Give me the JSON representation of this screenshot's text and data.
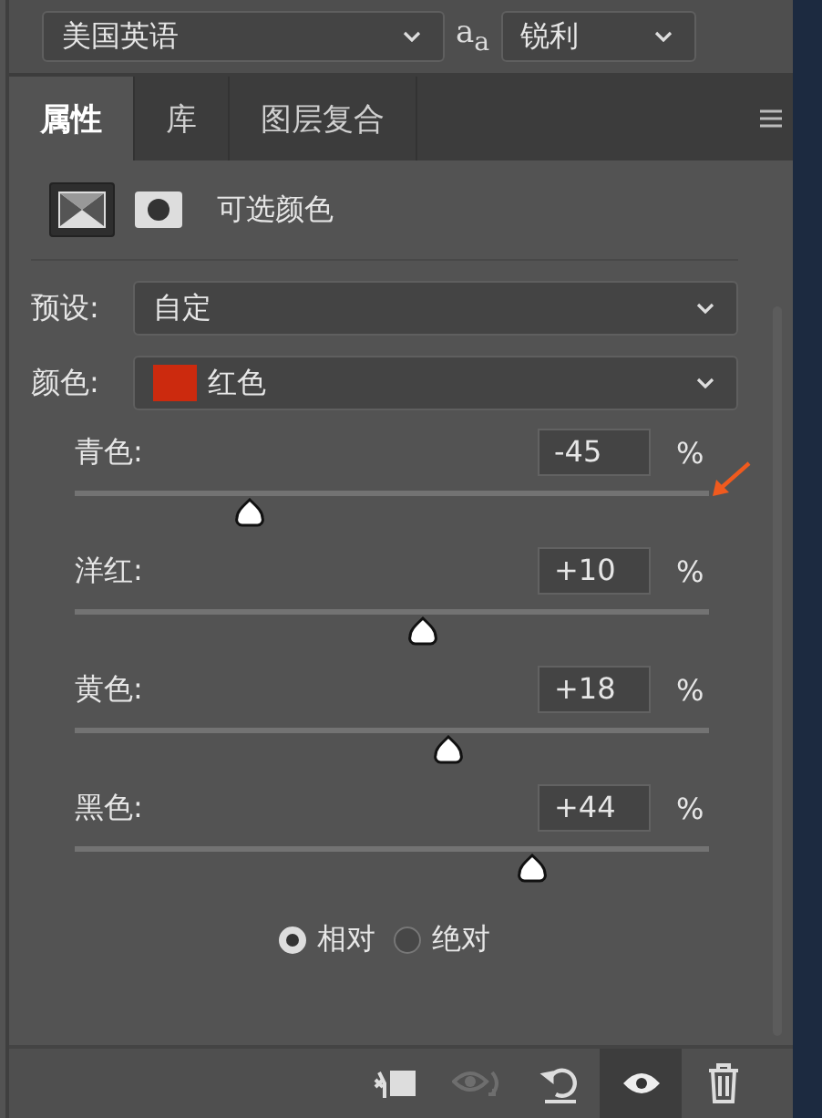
{
  "top_bar": {
    "language": "美国英语",
    "antialias_glyph": "a$_{a}$",
    "antialias": "锐利"
  },
  "tabs": [
    {
      "label": "属性",
      "selected": true
    },
    {
      "label": "库",
      "selected": false
    },
    {
      "label": "图层复合",
      "selected": false
    }
  ],
  "panel": {
    "title": "可选颜色",
    "mode_icons": [
      {
        "kind": "adjustment",
        "selected": true
      },
      {
        "kind": "mask",
        "selected": false
      }
    ]
  },
  "preset": {
    "label": "预设:",
    "value": "自定"
  },
  "color": {
    "label": "颜色:",
    "value": "红色",
    "color": "#cc2a0e"
  },
  "sliders": [
    {
      "name": "青色:",
      "value": "-45",
      "unit": "%",
      "level": 0.275
    },
    {
      "name": "洋红:",
      "value": "+10",
      "unit": "%",
      "level": 0.55
    },
    {
      "name": "黄色:",
      "value": "+18",
      "unit": "%",
      "level": 0.59
    },
    {
      "name": "黑色:",
      "value": "+44",
      "unit": "%",
      "level": 0.72
    }
  ],
  "method": [
    {
      "label": "相对",
      "selected": true
    },
    {
      "label": "绝对",
      "selected": false
    }
  ],
  "toolbar": [
    {
      "kind": "clip",
      "disabled": false,
      "selected": false
    },
    {
      "kind": "view-previous",
      "disabled": true,
      "selected": false
    },
    {
      "kind": "reset",
      "disabled": false,
      "selected": false
    },
    {
      "kind": "visibility",
      "disabled": false,
      "selected": true
    },
    {
      "kind": "delete",
      "disabled": false,
      "selected": false
    }
  ]
}
